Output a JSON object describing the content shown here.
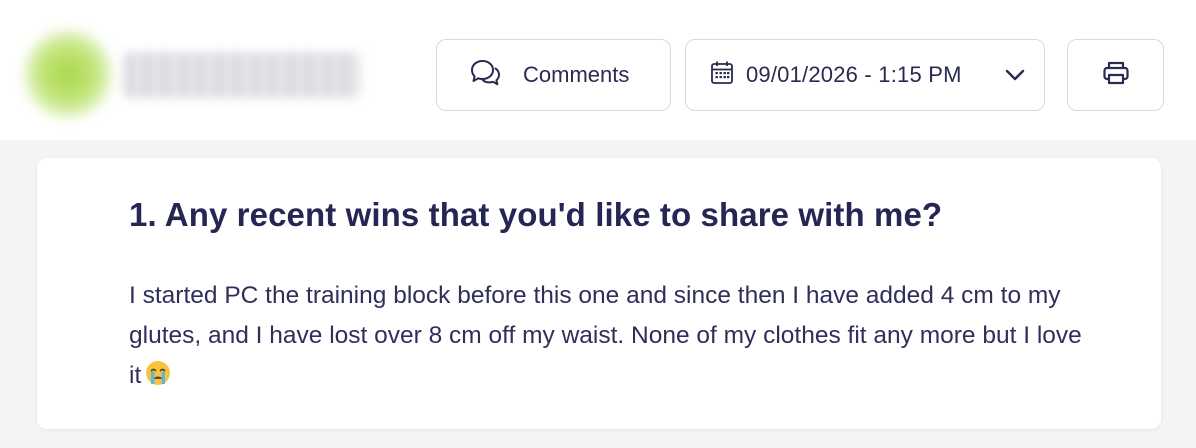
{
  "header": {
    "avatar": "user-avatar (blurred)",
    "user_name": "",
    "comments_label": "Comments",
    "comments_icon": "speech-bubbles-icon",
    "date_value": "09/01/2026 - 1:15 PM",
    "date_icon": "calendar-icon",
    "date_dropdown_icon": "chevron-down-icon",
    "print_icon": "printer-icon"
  },
  "card": {
    "question": "1. Any recent wins that you'd like to share with me?",
    "answer": "I started PC the training block before this one and since then I have added 4 cm to my glutes, and I have lost over 8 cm off my waist. None of my clothes fit any more but I love it",
    "answer_emoji": "crying-face-emoji"
  },
  "colors": {
    "text": "#2a2a52",
    "border": "#d8d8e0",
    "background": "#f4f4f6",
    "card": "#ffffff"
  }
}
